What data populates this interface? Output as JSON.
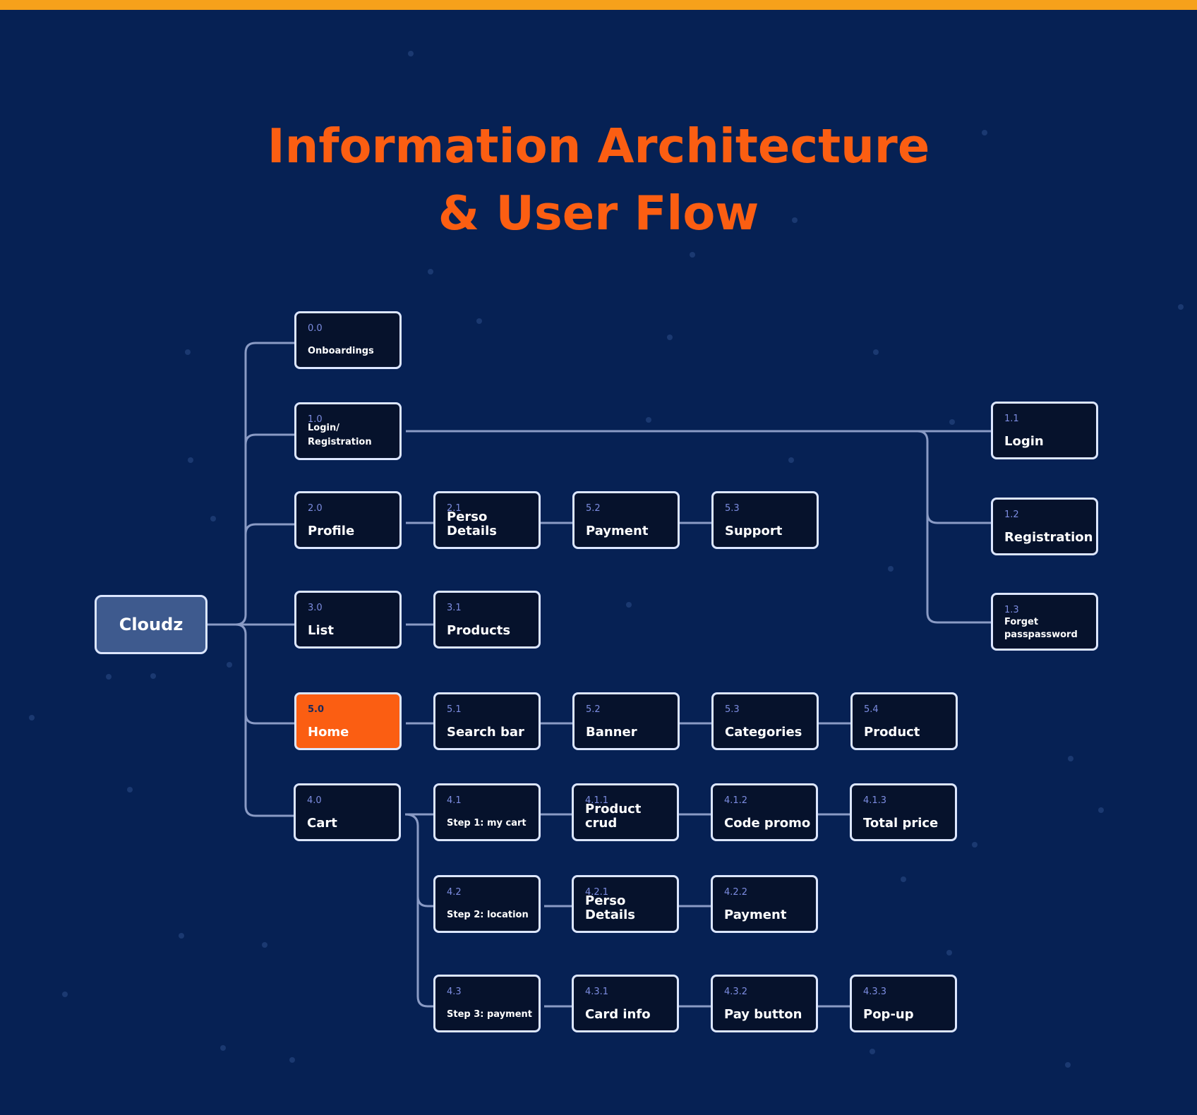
{
  "title": {
    "line1": "Information Architecture",
    "line2": "& User Flow"
  },
  "colors": {
    "accent": "#FB5E12",
    "background": "#062154",
    "top_bar": "#F6A11B",
    "node_fill": "#06122C",
    "node_border": "#DCE6FF",
    "root_fill": "#3E5A8E",
    "connector": "#8A9BC5"
  },
  "root": {
    "label": "Cloudz"
  },
  "nodes": {
    "onboardings": {
      "code": "0.0",
      "label": "Onboardings"
    },
    "login_registration": {
      "code": "1.0",
      "label": "Login/ Registration"
    },
    "login": {
      "code": "1.1",
      "label": "Login"
    },
    "registration": {
      "code": "1.2",
      "label": "Registration"
    },
    "forget_password": {
      "code": "1.3",
      "label": "Forget passpassword"
    },
    "profile": {
      "code": "2.0",
      "label": "Profile"
    },
    "perso_details": {
      "code": "2.1",
      "label": "Perso Details"
    },
    "profile_payment": {
      "code": "5.2",
      "label": "Payment"
    },
    "support": {
      "code": "5.3",
      "label": "Support"
    },
    "list": {
      "code": "3.0",
      "label": "List"
    },
    "products": {
      "code": "3.1",
      "label": "Products"
    },
    "home": {
      "code": "5.0",
      "label": "Home"
    },
    "search_bar": {
      "code": "5.1",
      "label": "Search bar"
    },
    "banner": {
      "code": "5.2",
      "label": "Banner"
    },
    "categories": {
      "code": "5.3",
      "label": "Categories"
    },
    "product": {
      "code": "5.4",
      "label": "Product"
    },
    "cart": {
      "code": "4.0",
      "label": "Cart"
    },
    "step1": {
      "code": "4.1",
      "label": "Step 1: my cart"
    },
    "product_crud": {
      "code": "4.1.1",
      "label": "Product crud"
    },
    "code_promo": {
      "code": "4.1.2",
      "label": "Code promo"
    },
    "total_price": {
      "code": "4.1.3",
      "label": "Total price"
    },
    "step2": {
      "code": "4.2",
      "label": "Step 2: location"
    },
    "step2_perso": {
      "code": "4.2.1",
      "label": "Perso Details"
    },
    "step2_payment": {
      "code": "4.2.2",
      "label": "Payment"
    },
    "step3": {
      "code": "4.3",
      "label": "Step 3: payment"
    },
    "card_info": {
      "code": "4.3.1",
      "label": "Card info"
    },
    "pay_button": {
      "code": "4.3.2",
      "label": "Pay button"
    },
    "popup": {
      "code": "4.3.3",
      "label": "Pop-up"
    }
  }
}
